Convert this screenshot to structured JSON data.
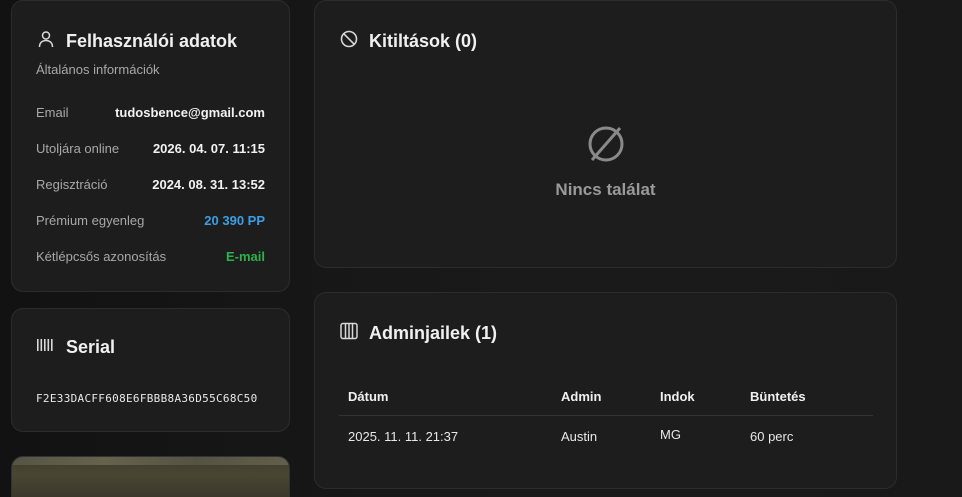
{
  "user_card": {
    "title": "Felhasználói adatok",
    "subtitle": "Általános információk",
    "rows": [
      {
        "label": "Email",
        "value": "tudosbence@gmail.com"
      },
      {
        "label": "Utoljára online",
        "value": "2026. 04. 07. 11:15"
      },
      {
        "label": "Regisztráció",
        "value": "2024. 08. 31. 13:52"
      },
      {
        "label": "Prémium egyenleg",
        "value": "20 390 PP",
        "color": "#3aa0e6"
      },
      {
        "label": "Kétlépcsős azonosítás",
        "value": "E-mail",
        "color": "#2db14a"
      }
    ],
    "icon": "user-icon"
  },
  "serial_card": {
    "title": "Serial",
    "code": "F2E33DACFF608E6FBBB8A36D55C68C50",
    "icon": "barcode-icon"
  },
  "bans_card": {
    "title": "Kitiltások (0)",
    "empty_text": "Nincs találat",
    "icon": "ban-icon",
    "empty_icon": "empty-set-icon"
  },
  "jail_card": {
    "title": "Adminjailek (1)",
    "icon": "jail-bars-icon",
    "columns": [
      "Dátum",
      "Admin",
      "Indok",
      "Büntetés"
    ],
    "rows": [
      [
        "2025. 11. 11. 21:37",
        "Austin",
        "MG",
        "60 perc"
      ]
    ]
  },
  "colors": {
    "accent_blue": "#3aa0e6",
    "accent_green": "#2db14a",
    "card_bg": "#1d1d1d"
  }
}
